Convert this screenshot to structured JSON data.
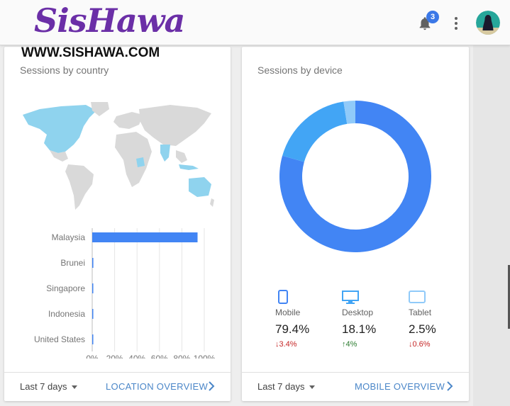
{
  "brand": {
    "logo_text": "SisHawa",
    "url_text": "WWW.SISHAWA.COM"
  },
  "header": {
    "notification_count": "3"
  },
  "country_card": {
    "title": "Sessions by country",
    "footer_period": "Last 7 days",
    "footer_link": "LOCATION OVERVIEW"
  },
  "device_card": {
    "title": "Sessions by device",
    "footer_period": "Last 7 days",
    "footer_link": "MOBILE OVERVIEW",
    "devices": [
      {
        "name": "Mobile",
        "value": "79.4%",
        "delta": "3.4%",
        "trend": "down"
      },
      {
        "name": "Desktop",
        "value": "18.1%",
        "delta": "4%",
        "trend": "up"
      },
      {
        "name": "Tablet",
        "value": "2.5%",
        "delta": "0.6%",
        "trend": "down"
      }
    ]
  },
  "colors": {
    "primary_blue": "#4285f4",
    "desktop_blue": "#42a5f5",
    "tablet_blue": "#90caf9",
    "map_highlight": "#8fd3ee",
    "map_base": "#d9d9d9"
  },
  "chart_data": [
    {
      "type": "bar",
      "orientation": "horizontal",
      "categories": [
        "Malaysia",
        "Brunei",
        "Singapore",
        "Indonesia",
        "United States"
      ],
      "values": [
        94,
        1,
        0.5,
        0.5,
        0.2
      ],
      "x_ticks": [
        "0%",
        "20%",
        "40%",
        "60%",
        "80%",
        "100%"
      ],
      "xlim": [
        0,
        100
      ],
      "grid": true
    },
    {
      "type": "pie",
      "donut": true,
      "categories": [
        "Mobile",
        "Desktop",
        "Tablet"
      ],
      "values": [
        79.4,
        18.1,
        2.5
      ]
    }
  ]
}
